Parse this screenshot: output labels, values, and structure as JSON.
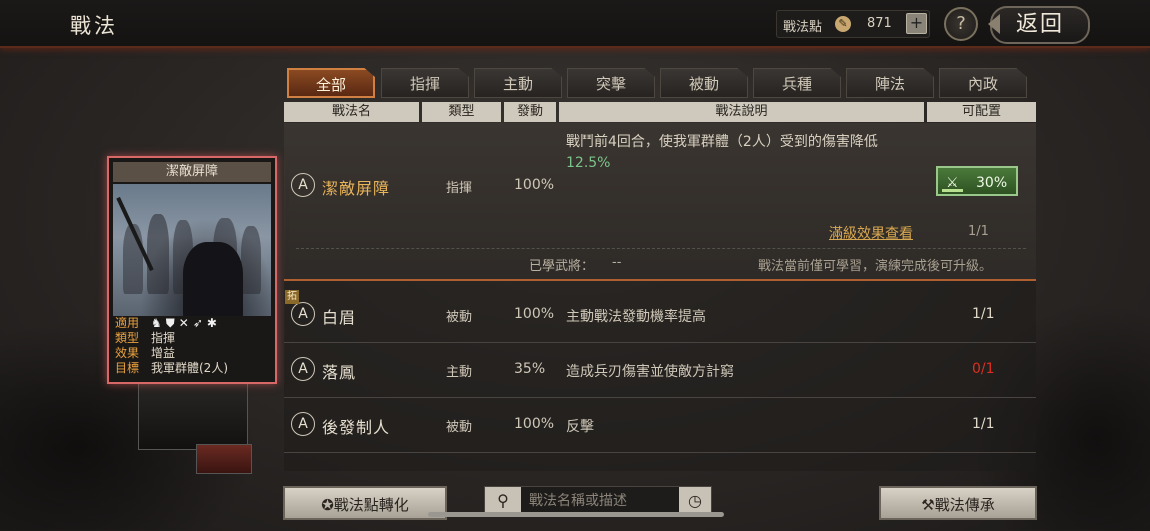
{
  "header": {
    "title": "戰法",
    "points_label": "戰法點",
    "points_value": "871",
    "plus": "+",
    "help": "?",
    "back": "返回"
  },
  "tabs": [
    "全部",
    "指揮",
    "主動",
    "突擊",
    "被動",
    "兵種",
    "陣法",
    "內政"
  ],
  "columns": [
    "戰法名",
    "類型",
    "發動",
    "戰法說明",
    "可配置"
  ],
  "selected": {
    "marker": "A",
    "name": "潔敵屏障",
    "type": "指揮",
    "rate": "100%",
    "desc": "戰鬥前4回合，使我軍群體（2人）受到的傷害降低",
    "value": "12.5%",
    "gauge": "30%",
    "detail_link": "滿級效果查看",
    "level": "1/1",
    "learned_label": "已學武將：",
    "learned_value": "--",
    "note": "戰法當前僅可學習，演練完成後可升級。"
  },
  "rows": [
    {
      "marker": "A",
      "name": "白眉",
      "type": "被動",
      "rate": "100%",
      "desc": "主動戰法發動機率提高",
      "alloc": "1/1"
    },
    {
      "marker": "A",
      "name": "落鳳",
      "type": "主動",
      "rate": "35%",
      "desc": "造成兵刃傷害並使敵方計窮",
      "alloc": "0/1"
    },
    {
      "marker": "A",
      "name": "後發制人",
      "type": "被動",
      "rate": "100%",
      "desc": "反擊",
      "alloc": "1/1"
    }
  ],
  "expand_tag": "拓",
  "card": {
    "title": "潔敵屏障",
    "apply_label": "適用",
    "type_label": "類型",
    "type_value": "指揮",
    "effect_label": "效果",
    "effect_value": "增益",
    "target_label": "目標",
    "target_value": "我軍群體(2人)",
    "icons": "♞⛊✕➶✱"
  },
  "bottom": {
    "convert": "戰法點轉化",
    "search_placeholder": "戰法名稱或描述",
    "inherit": "戰法傳承"
  },
  "colors": {
    "accent": "#d08040",
    "selected_name": "#e8b45a",
    "value_green": "#7cc48a",
    "alert_red": "#d83020"
  }
}
